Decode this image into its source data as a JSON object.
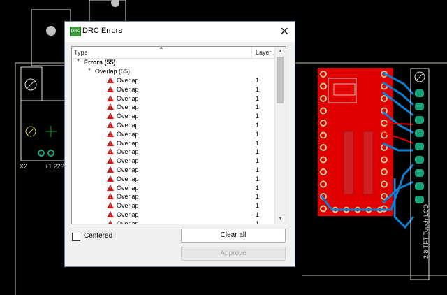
{
  "dialog": {
    "title": "DRC Errors",
    "icon": "drc-app-icon",
    "icon_text": "DRC",
    "close_glyph": "✕"
  },
  "list": {
    "columns": {
      "type": "Type",
      "layer": "Layer"
    },
    "group": {
      "label": "Errors (55)"
    },
    "subgroup": {
      "label": "Overlap (55)"
    },
    "items": [
      {
        "label": "Overlap",
        "layer": "1"
      },
      {
        "label": "Overlap",
        "layer": "1"
      },
      {
        "label": "Overlap",
        "layer": "1"
      },
      {
        "label": "Overlap",
        "layer": "1"
      },
      {
        "label": "Overlap",
        "layer": "1"
      },
      {
        "label": "Overlap",
        "layer": "1"
      },
      {
        "label": "Overlap",
        "layer": "1"
      },
      {
        "label": "Overlap",
        "layer": "1"
      },
      {
        "label": "Overlap",
        "layer": "1"
      },
      {
        "label": "Overlap",
        "layer": "1"
      },
      {
        "label": "Overlap",
        "layer": "1"
      },
      {
        "label": "Overlap",
        "layer": "1"
      },
      {
        "label": "Overlap",
        "layer": "1"
      },
      {
        "label": "Overlap",
        "layer": "1"
      },
      {
        "label": "Overlap",
        "layer": "1"
      },
      {
        "label": "Overlap",
        "layer": "1"
      },
      {
        "label": "Overlap",
        "layer": "1"
      }
    ]
  },
  "controls": {
    "centered_label": "Centered",
    "centered_checked": false,
    "clear_all": "Clear all",
    "approve": "Approve"
  },
  "board": {
    "labels": {
      "x2": "X2",
      "j1": "+1 22?",
      "lcd": "2.8 TFT Touch LCD"
    },
    "colors": {
      "background": "#000000",
      "outline": "#e0e0e0",
      "copper_top": "#e00000",
      "copper_bottom": "#0e7fd0",
      "pad": "#17a27a",
      "board_edge": "#c8c0a0"
    }
  }
}
